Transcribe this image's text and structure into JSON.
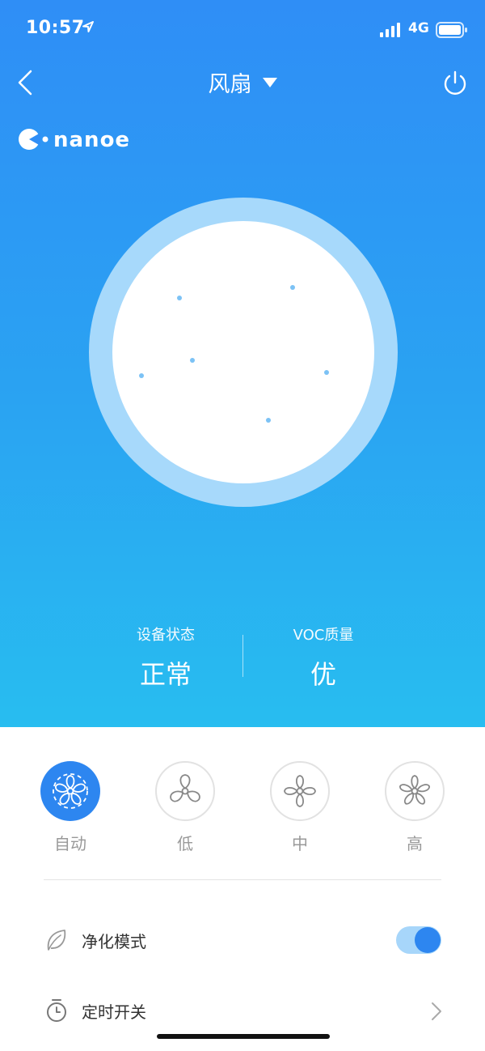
{
  "status_bar": {
    "time": "10:57",
    "network": "4G"
  },
  "nav": {
    "title": "风扇"
  },
  "brand": {
    "logo_text": "nanoe"
  },
  "stats": {
    "device_status_label": "设备状态",
    "device_status_value": "正常",
    "voc_label": "VOC质量",
    "voc_value": "优"
  },
  "fan_modes": [
    {
      "label": "自动",
      "active": true
    },
    {
      "label": "低",
      "active": false
    },
    {
      "label": "中",
      "active": false
    },
    {
      "label": "高",
      "active": false
    }
  ],
  "settings": {
    "purify_label": "净化模式",
    "purify_on": true,
    "timer_label": "定时开关"
  },
  "colors": {
    "accent": "#2d86f0",
    "ring": "#a7d9fb",
    "toggle_track": "#a7d6fa"
  },
  "icons": [
    "back-icon",
    "caret-down-icon",
    "power-icon",
    "location-arrow-icon",
    "signal-icon",
    "battery-icon",
    "fan-icon",
    "leaf-icon",
    "timer-icon",
    "chevron-right-icon"
  ]
}
